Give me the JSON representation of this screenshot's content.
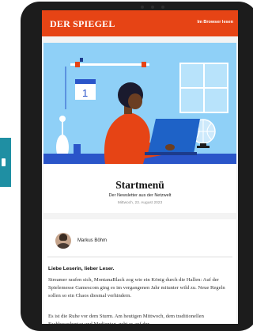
{
  "header": {
    "logo": "DER SPIEGEL",
    "browser_link": "Im Browser lesen"
  },
  "newsletter": {
    "title": "Startmenü",
    "subtitle": "Der Newsletter aus der Netzwelt",
    "date": "Mittwoch, 23. August 2023"
  },
  "author": {
    "name": "Markus Böhm"
  },
  "body": {
    "greeting": "Liebe Leserin, lieber Leser.",
    "paragraph1": "Streamer raufen sich, MontanaBlack zog wie ein König durch die Hallen: Auf der Spielemesse Gamescom ging es im vergangenen Jahr mitunter wild zu. Neue Regeln sollen so ein Chaos diesmal verhindern.",
    "paragraph2": "Es ist die Ruhe vor dem Sturm. Am heutigen Mittwoch, dem traditionellen Fachbesuchertag und Medientag, geht es auf der"
  },
  "colors": {
    "brand": "#e64415",
    "illustration_bg": "#8fd0f7",
    "side_tab": "#1f8fa3"
  }
}
